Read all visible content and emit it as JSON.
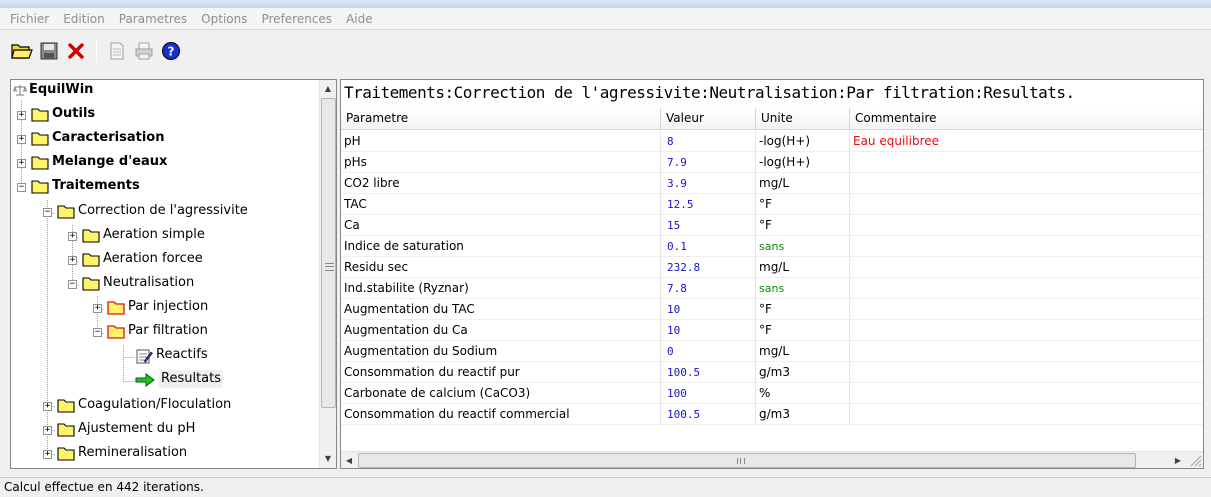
{
  "menu": [
    "Fichier",
    "Edition",
    "Parametres",
    "Options",
    "Preferences",
    "Aide"
  ],
  "toolbar": {
    "icons": [
      "open-folder-icon",
      "save-disk-icon",
      "delete-x-icon",
      "document-icon",
      "print-icon",
      "help-icon"
    ]
  },
  "tree": {
    "root": "EquilWin",
    "nodes": {
      "outils": "Outils",
      "caracterisation": "Caracterisation",
      "melange": "Melange d'eaux",
      "traitements": "Traitements",
      "correction": "Correction de l'agressivite",
      "aeration_simple": "Aeration simple",
      "aeration_forcee": "Aeration forcee",
      "neutralisation": "Neutralisation",
      "par_injection": "Par injection",
      "par_filtration": "Par filtration",
      "reactifs": "Reactifs",
      "resultats": "Resultats",
      "coagulation": "Coagulation/Floculation",
      "ajustement": "Ajustement du pH",
      "remineralisation": "Remineralisation"
    }
  },
  "breadcrumb": "Traitements:Correction de l'agressivite:Neutralisation:Par filtration:Resultats.",
  "grid": {
    "headers": [
      "Parametre",
      "Valeur",
      "Unite",
      "Commentaire"
    ],
    "rows": [
      {
        "param": "pH",
        "value": "8",
        "unit": "-log(H+)",
        "comment": "Eau equilibree"
      },
      {
        "param": "pHs",
        "value": "7.9",
        "unit": "-log(H+)",
        "comment": ""
      },
      {
        "param": "CO2 libre",
        "value": "3.9",
        "unit": "mg/L",
        "comment": ""
      },
      {
        "param": "TAC",
        "value": "12.5",
        "unit": "°F",
        "comment": ""
      },
      {
        "param": "Ca",
        "value": "15",
        "unit": "°F",
        "comment": ""
      },
      {
        "param": "Indice de saturation",
        "value": "0.1",
        "unit": "sans",
        "comment": ""
      },
      {
        "param": "Residu sec",
        "value": "232.8",
        "unit": "mg/L",
        "comment": ""
      },
      {
        "param": "Ind.stabilite (Ryznar)",
        "value": "7.8",
        "unit": "sans",
        "comment": ""
      },
      {
        "param": "Augmentation du TAC",
        "value": "10",
        "unit": "°F",
        "comment": ""
      },
      {
        "param": "Augmentation du Ca",
        "value": "10",
        "unit": "°F",
        "comment": ""
      },
      {
        "param": "Augmentation du Sodium",
        "value": "0",
        "unit": "mg/L",
        "comment": ""
      },
      {
        "param": "Consommation du reactif pur",
        "value": "100.5",
        "unit": "g/m3",
        "comment": ""
      },
      {
        "param": "Carbonate de calcium (CaCO3)",
        "value": "100",
        "unit": "%",
        "comment": ""
      },
      {
        "param": "Consommation du reactif commercial",
        "value": "100.5",
        "unit": "g/m3",
        "comment": ""
      }
    ],
    "colors": {
      "value": "#1515d0",
      "unit_sans": "#0a8a0a",
      "comment": "#e01010"
    }
  },
  "status": "Calcul effectue en 442 iterations."
}
